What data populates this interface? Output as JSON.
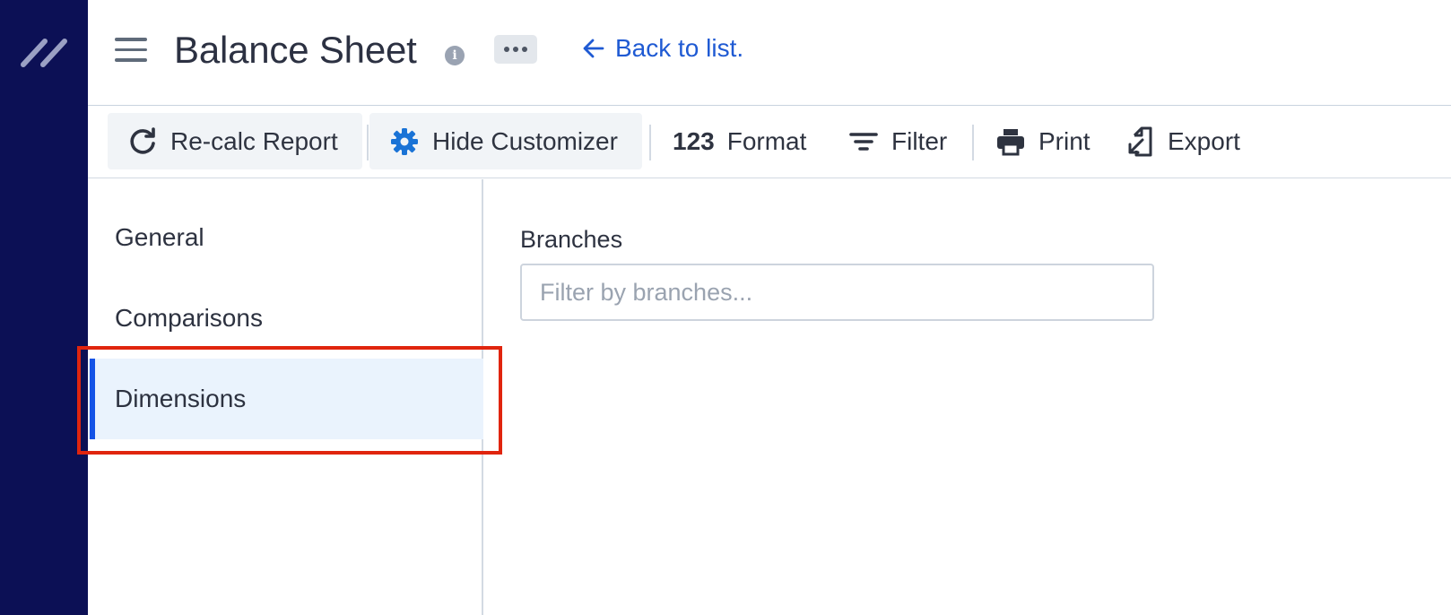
{
  "header": {
    "title": "Balance Sheet",
    "info_icon": "i",
    "back_link": "Back to list."
  },
  "toolbar": {
    "recalc_label": "Re-calc Report",
    "customizer_label": "Hide Customizer",
    "format_glyph": "123",
    "format_label": "Format",
    "filter_label": "Filter",
    "print_label": "Print",
    "export_label": "Export"
  },
  "sidebar": {
    "items": [
      {
        "label": "General",
        "active": false
      },
      {
        "label": "Comparisons",
        "active": false
      },
      {
        "label": "Dimensions",
        "active": true
      }
    ]
  },
  "panel": {
    "branches_label": "Branches",
    "branches_placeholder": "Filter by branches..."
  },
  "colors": {
    "rail": "#0c1055",
    "link": "#1f5ad3",
    "active_bg": "#eaf3fd",
    "active_bar": "#1553e6",
    "highlight": "#e0250e",
    "gear": "#1a73d6"
  },
  "icons": [
    "logo-icon",
    "hamburger-icon",
    "info-icon",
    "more-icon",
    "arrow-left-icon",
    "refresh-icon",
    "gear-icon",
    "filter-icon",
    "printer-icon",
    "export-icon"
  ]
}
